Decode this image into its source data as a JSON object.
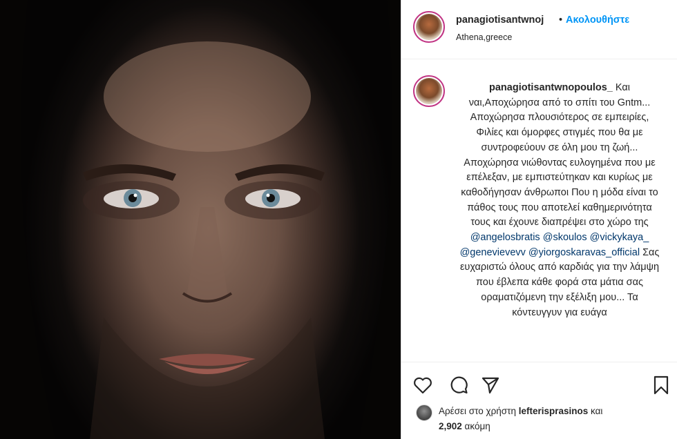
{
  "photo": {
    "alt_icon": "portrait-photo"
  },
  "header": {
    "username": "panagiotisantwnoj",
    "separator": "•",
    "follow_label": "Ακολουθήστε",
    "location": "Athena,greece"
  },
  "caption": {
    "username": "panagiotisantwnopoulos_",
    "text_part1": " Και ναι,Αποχώρησα από το σπίτι του Gntm... Αποχώρησα πλουσιότερος σε εμπειρίες, Φιλίες και όμορφες στιγμές που θα με συντροφεύουν σε όλη μου τη ζωή... Αποχώρησα νιώθοντας ευλογημένα που με επέλεξαν, με εμπιστεύτηκαν και κυρίως με καθοδήγησαν άνθρωποι Που η μόδα είναι το πάθος τους που αποτελεί καθημερινότητα τους και έχουνε διαπρέψει στο χώρο της ",
    "mention1": "@angelosbratis",
    "mention2": "@skoulos",
    "mention3": "@vickykaya_",
    "mention4": "@genevievevv",
    "mention5": "@yiorgoskaravas_official",
    "text_part2": " Σας ευχαριστώ όλους από καρδιάς για την λάμψη που έβλεπα κάθε φορά στα μάτια σας οραματιζόμενη την εξέλιξη μου... Τα κόντευγγυν για ευάγα"
  },
  "actions": {
    "like_icon": "heart-icon",
    "comment_icon": "comment-bubble-icon",
    "share_icon": "paper-plane-icon",
    "save_icon": "bookmark-icon"
  },
  "likes": {
    "prefix": "Αρέσει στο χρήστη ",
    "liker": "lefterisprasinos",
    "suffix": " και",
    "count": "2,902",
    "count_suffix": " ακόμη"
  },
  "colors": {
    "link_blue": "#0095f6",
    "mention_blue": "#00376b",
    "story_ring": "#c13584"
  }
}
